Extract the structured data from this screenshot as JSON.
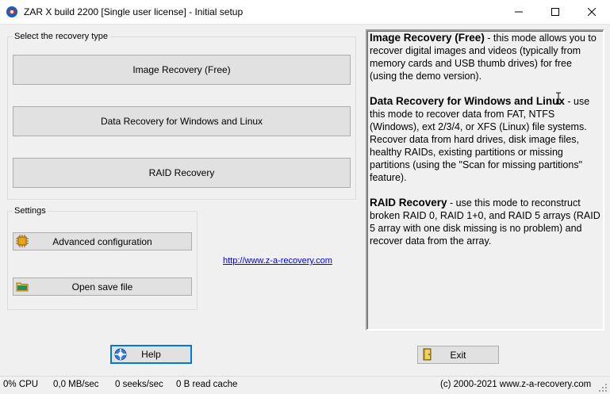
{
  "window": {
    "title": "ZAR X build 2200 [Single user license] - Initial setup"
  },
  "recovery_group": {
    "label": "Select the recovery type",
    "buttons": {
      "image": "Image Recovery (Free)",
      "data": "Data Recovery for Windows and Linux",
      "raid": "RAID Recovery"
    }
  },
  "settings_group": {
    "label": "Settings",
    "advanced": "Advanced configuration",
    "open_save": "Open save file"
  },
  "link": "http://www.z-a-recovery.com",
  "info": {
    "image_title": "Image Recovery (Free)",
    "image_text": " - this mode allows you to recover digital images and videos (typically from memory cards and USB thumb drives) for free (using the demo version).",
    "data_title": "Data Recovery for Windows and Linux",
    "data_text": " - use this mode to recover data from FAT, NTFS (Windows), ext 2/3/4, or XFS (Linux) file systems. Recover data from hard drives, disk image files, healthy RAIDs, existing partitions or missing partitions (using the \"Scan for missing partitions\" feature).",
    "raid_title": "RAID Recovery",
    "raid_text": " - use this mode to reconstruct broken RAID 0, RAID 1+0, and RAID 5 arrays (RAID 5 array with one disk missing is no problem) and recover data from the array."
  },
  "bottom": {
    "help": "Help",
    "exit": "Exit"
  },
  "status": {
    "cpu": "0% CPU",
    "speed": "0,0 MB/sec",
    "seeks": "0 seeks/sec",
    "cache": "0 B read cache",
    "copyright": "(c) 2000-2021 www.z-a-recovery.com"
  },
  "icons": {
    "app": "zar-logo-icon",
    "advanced": "chip-icon",
    "open": "folder-icon",
    "help": "help-icon",
    "exit": "door-exit-icon"
  }
}
